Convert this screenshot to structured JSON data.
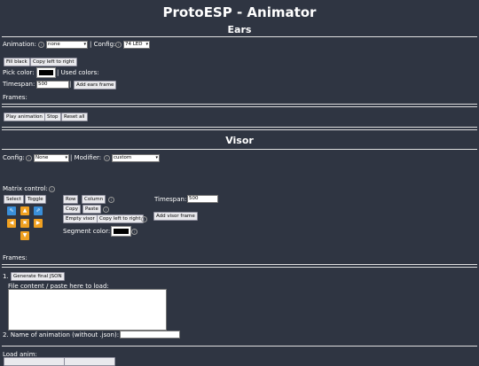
{
  "page": {
    "title": "ProtoESP - Animator"
  },
  "ears": {
    "heading": "Ears",
    "animation_label": "Animation:",
    "animation_value": "none",
    "config_label": "| Config:",
    "config_value": "74 LED",
    "fill_black": "Fill black",
    "copy_left_right": "Copy left to right",
    "pick_color_label": "Pick color:",
    "used_colors_label": "| Used colors:",
    "timespan_label": "Timespan:",
    "timespan_value": "500",
    "add_frame": "Add ears frame",
    "frames_label": "Frames:",
    "play": "Play animation",
    "stop": "Stop",
    "reset": "Reset all"
  },
  "visor": {
    "heading": "Visor",
    "config_label": "Config:",
    "config_value": "None",
    "modifier_label": "| Modifier:",
    "modifier_value": "custom",
    "matrix_label": "Matrix control:",
    "select": "Select",
    "toggle": "Toggle",
    "row": "Row",
    "column": "Column",
    "copy": "Copy",
    "paste": "Paste",
    "empty": "Empty visor",
    "copy_left_right": "Copy left to right",
    "segment_color_label": "Segment color:",
    "timespan_label": "Timespan:",
    "timespan_value": "500",
    "add_frame": "Add visor frame",
    "frames_label": "Frames:"
  },
  "export": {
    "step1": "1.",
    "generate": "Generate final JSON",
    "file_content_label": "File content / paste here to load:",
    "step2": "2. Name of animation (without .json):",
    "load_label": "Load anim:"
  },
  "icons": {
    "info": "i",
    "arrow_up_left": "⇖",
    "arrow_up": "▲",
    "arrow_up_right": "⇗",
    "arrow_left": "◀",
    "arrow_center": "✖",
    "arrow_right": "▶",
    "arrow_down": "▼"
  },
  "colors": {
    "background": "#2f3542",
    "accent_orange": "#f0a020",
    "accent_blue": "#3a8fd9"
  }
}
